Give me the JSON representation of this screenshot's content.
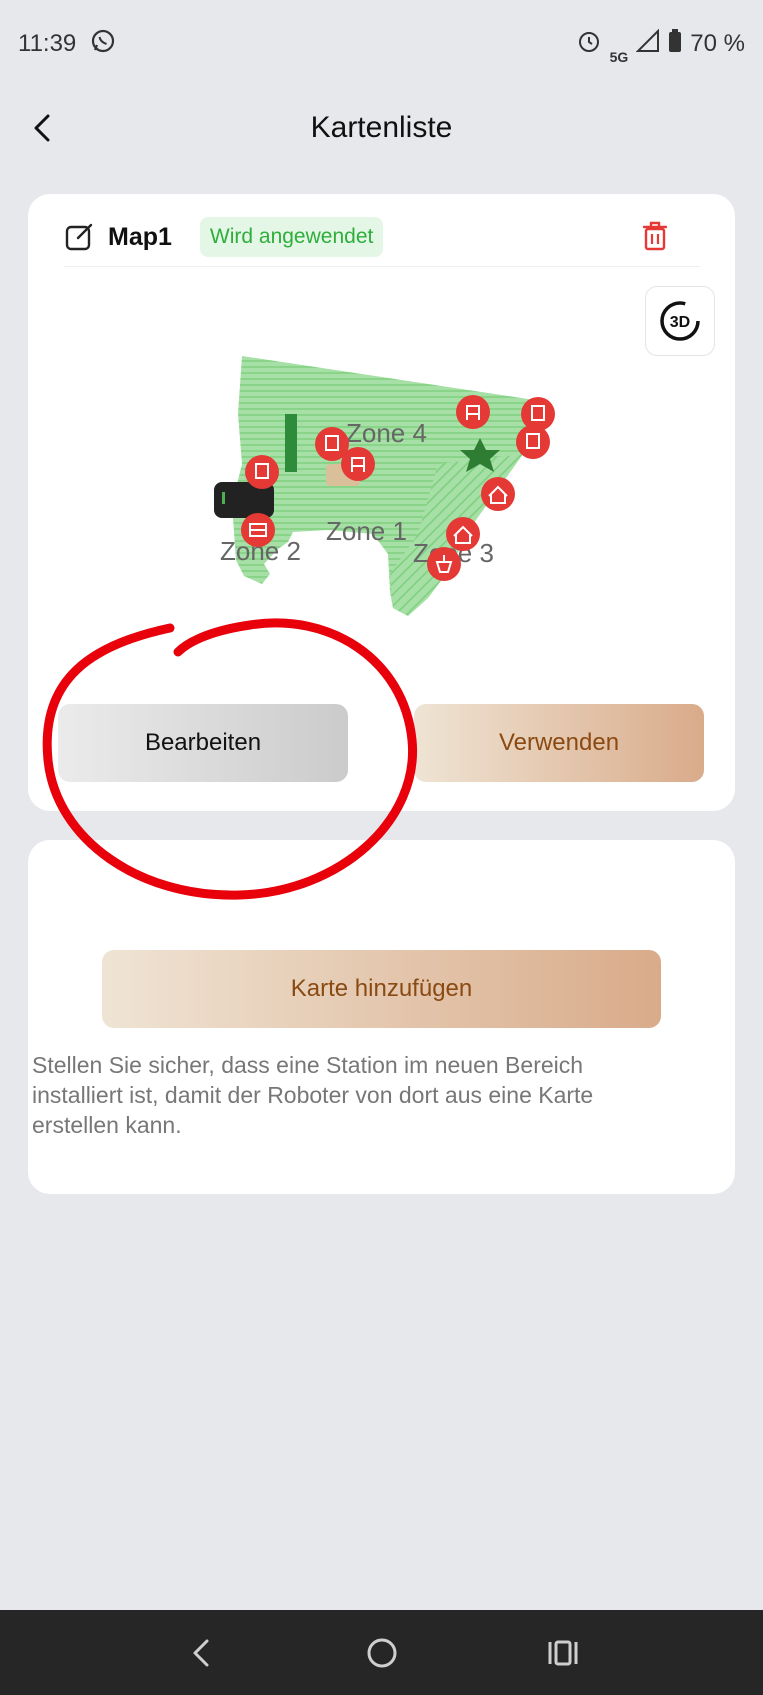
{
  "status": {
    "time": "11:39",
    "network": "5G",
    "battery": "70 %"
  },
  "header": {
    "title": "Kartenliste"
  },
  "map_card": {
    "name": "Map1",
    "badge": "Wird angewendet",
    "zones": [
      "Zone 4",
      "Zone 1",
      "Zone 2",
      "Zone 3"
    ],
    "edit_label": "Bearbeiten",
    "use_label": "Verwenden",
    "badge_color": "#2fae3c",
    "map_color": "#8fd68f",
    "marker_color": "#e53935"
  },
  "add_card": {
    "button_label": "Karte hinzufügen",
    "note": "Stellen Sie sicher, dass eine Station im neuen Bereich installiert ist, damit der Roboter von dort aus eine Karte erstellen kann."
  },
  "annotation": {
    "color": "#e8000b"
  },
  "icons": {
    "status": [
      "whatsapp-icon",
      "alarm-icon",
      "signal-icon",
      "battery-icon"
    ],
    "card": [
      "edit-icon",
      "trash-icon",
      "3d-view-icon"
    ],
    "nav": [
      "nav-back-icon",
      "nav-home-icon",
      "nav-recents-icon"
    ]
  }
}
